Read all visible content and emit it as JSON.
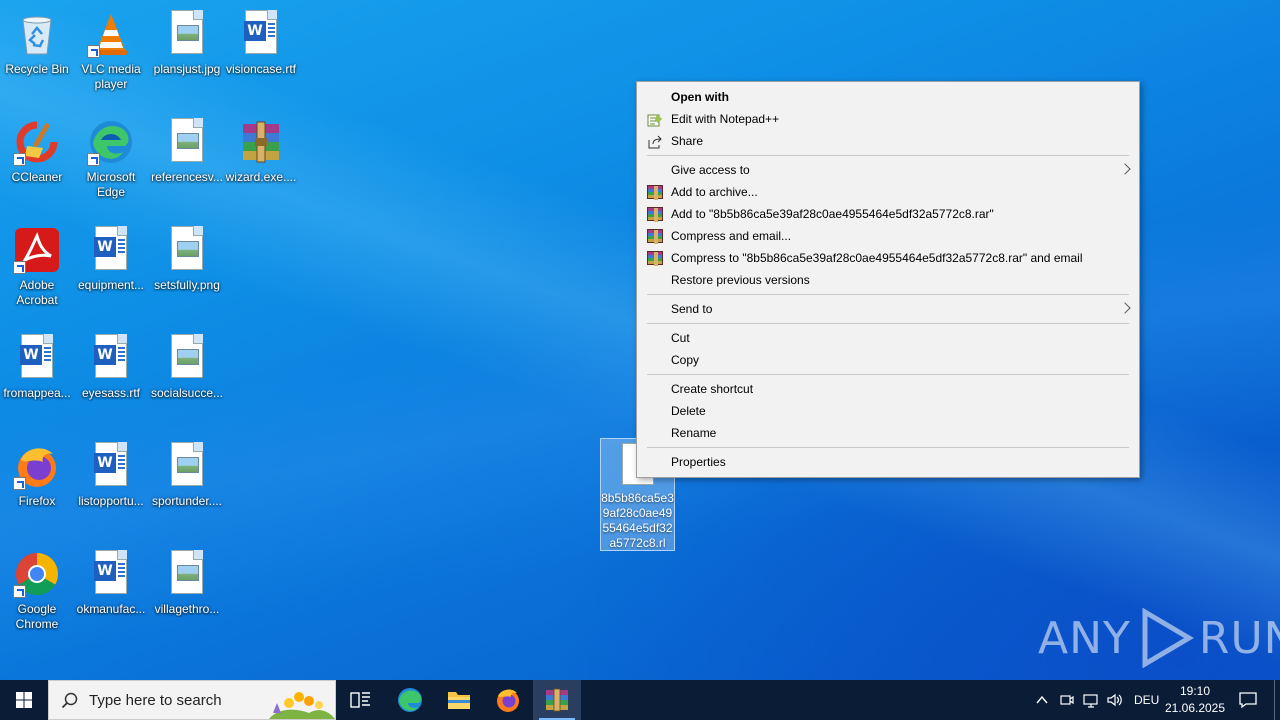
{
  "desktop": {
    "icons": [
      {
        "label": "Recycle Bin",
        "icon": "recycle-bin-icon"
      },
      {
        "label": "VLC media player",
        "icon": "vlc-icon"
      },
      {
        "label": "plansjust.jpg",
        "icon": "image-file-icon"
      },
      {
        "label": "visioncase.rtf",
        "icon": "word-document-icon"
      },
      {
        "label": "CCleaner",
        "icon": "ccleaner-icon"
      },
      {
        "label": "Microsoft Edge",
        "icon": "edge-icon"
      },
      {
        "label": "referencesv...",
        "icon": "image-file-icon"
      },
      {
        "label": "wizard.exe....",
        "icon": "winrar-archive-icon"
      },
      {
        "label": "Adobe Acrobat",
        "icon": "acrobat-icon"
      },
      {
        "label": "equipment...",
        "icon": "word-document-icon"
      },
      {
        "label": "setsfully.png",
        "icon": "image-file-icon"
      },
      {
        "label": "fromappea...",
        "icon": "word-document-icon"
      },
      {
        "label": "eyesass.rtf",
        "icon": "word-document-icon"
      },
      {
        "label": "socialsucce...",
        "icon": "image-file-icon"
      },
      {
        "label": "Firefox",
        "icon": "firefox-icon"
      },
      {
        "label": "listopportu...",
        "icon": "word-document-icon"
      },
      {
        "label": "sportunder....",
        "icon": "image-file-icon"
      },
      {
        "label": "Google Chrome",
        "icon": "chrome-icon"
      },
      {
        "label": "okmanufac...",
        "icon": "word-document-icon"
      },
      {
        "label": "villagethro...",
        "icon": "image-file-icon"
      }
    ],
    "selected_file": {
      "label": "8b5b86ca5e39af28c0ae4955464e5df32a5772c8.rl"
    }
  },
  "context_menu": {
    "open_with": "Open with",
    "edit_notepad": "Edit with Notepad++",
    "share": "Share",
    "give_access": "Give access to",
    "add_archive": "Add to archive...",
    "add_rar": "Add to \"8b5b86ca5e39af28c0ae4955464e5df32a5772c8.rar\"",
    "compress_email": "Compress and email...",
    "compress_rar_email": "Compress to \"8b5b86ca5e39af28c0ae4955464e5df32a5772c8.rar\" and email",
    "restore": "Restore previous versions",
    "send_to": "Send to",
    "cut": "Cut",
    "copy": "Copy",
    "create_shortcut": "Create shortcut",
    "delete": "Delete",
    "rename": "Rename",
    "properties": "Properties"
  },
  "watermark": {
    "left": "ANY",
    "right": "RUN"
  },
  "taskbar": {
    "search_placeholder": "Type here to search",
    "language": "DEU",
    "time": "19:10",
    "date": "21.06.2025"
  },
  "colors": {
    "accent": "#0a74da",
    "taskbar": "#0b1c36",
    "menu_bg": "#f2f2f2"
  }
}
